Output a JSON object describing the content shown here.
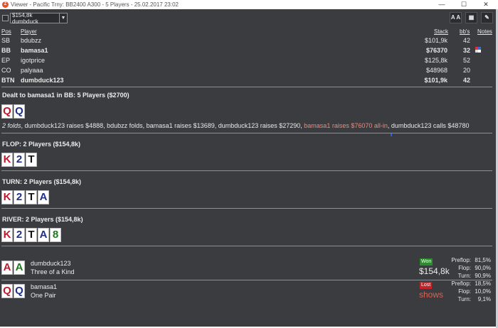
{
  "window": {
    "title": "Viewer - Pacific Trny: BB2400 A300 - 5 Players - 25.02.2017 23:02",
    "minimize": "—",
    "maximize": "☐",
    "close": "✕"
  },
  "toolbar": {
    "dropdown_value": "$154,8k dumbduck",
    "font_button": "A A",
    "grid_button": "▦",
    "edit_button": "✎"
  },
  "table_headers": {
    "pos": "Pos",
    "player": "Player",
    "stack": "Stack",
    "bbs": "bb's",
    "notes": "Notes"
  },
  "players": [
    {
      "pos": "SB",
      "name": "bdubzz",
      "stack": "$101,9k",
      "bbs": "42",
      "bold": false
    },
    {
      "pos": "BB",
      "name": "bamasa1",
      "stack": "$76370",
      "bbs": "32",
      "bold": true
    },
    {
      "pos": "EP",
      "name": "igotprice",
      "stack": "$125,8k",
      "bbs": "52",
      "bold": false
    },
    {
      "pos": "CO",
      "name": "palyaaa",
      "stack": "$48968",
      "bbs": "20",
      "bold": false
    },
    {
      "pos": "BTN",
      "name": "dumbduck123",
      "stack": "$101,9k",
      "bbs": "42",
      "bold": true
    }
  ],
  "preflop": {
    "title": "Dealt to bamasa1 in BB: 5 Players ($2700)",
    "hole_cards": [
      {
        "rank": "Q",
        "suit": "h"
      },
      {
        "rank": "Q",
        "suit": "d"
      }
    ],
    "action_folds": "2 folds",
    "action_main": ", dumbduck123 raises $4888, bdubzz folds, bamasa1 raises $13689, dumbduck123 raises $27290, ",
    "action_allin": "bamasa1 raises $76070 all-in",
    "action_end": ", dumbduck123 calls $48780"
  },
  "streets": [
    {
      "title": "FLOP: 2 Players ($154,8k)",
      "cards": [
        {
          "rank": "K",
          "suit": "h"
        },
        {
          "rank": "2",
          "suit": "d"
        },
        {
          "rank": "T",
          "suit": "s"
        }
      ]
    },
    {
      "title": "TURN: 2 Players ($154,8k)",
      "cards": [
        {
          "rank": "K",
          "suit": "h"
        },
        {
          "rank": "2",
          "suit": "d"
        },
        {
          "rank": "T",
          "suit": "s"
        },
        {
          "rank": "A",
          "suit": "d"
        }
      ]
    },
    {
      "title": "RIVER: 2 Players ($154,8k)",
      "cards": [
        {
          "rank": "K",
          "suit": "h"
        },
        {
          "rank": "2",
          "suit": "d"
        },
        {
          "rank": "T",
          "suit": "s"
        },
        {
          "rank": "A",
          "suit": "d"
        },
        {
          "rank": "8",
          "suit": "c"
        }
      ]
    }
  ],
  "results": [
    {
      "cards": [
        {
          "rank": "A",
          "suit": "h"
        },
        {
          "rank": "A",
          "suit": "c"
        }
      ],
      "name": "dumbduck123",
      "hand": "Three of a Kind",
      "badge": "Won",
      "amount": "$154,8k",
      "stats": [
        {
          "label": "Preflop:",
          "value": "81,5%"
        },
        {
          "label": "Flop:",
          "value": "90,0%"
        },
        {
          "label": "Turn:",
          "value": "90,9%"
        }
      ]
    },
    {
      "cards": [
        {
          "rank": "Q",
          "suit": "h"
        },
        {
          "rank": "Q",
          "suit": "d"
        }
      ],
      "name": "bamasa1",
      "hand": "One Pair",
      "badge": "Lost",
      "amount": "shows",
      "stats": [
        {
          "label": "Preflop:",
          "value": "18,5%"
        },
        {
          "label": "Flop:",
          "value": "10,0%"
        },
        {
          "label": "Turn:",
          "value": "9,1%"
        }
      ]
    }
  ],
  "colors": {
    "background": "#3a3c40",
    "hearts": "#c0172a",
    "diamonds": "#1f2f8a",
    "spades": "#111111",
    "clubs": "#1d7a1d",
    "allin": "#f08a7a",
    "won": "#2d8a2d",
    "lost": "#c0242a"
  }
}
